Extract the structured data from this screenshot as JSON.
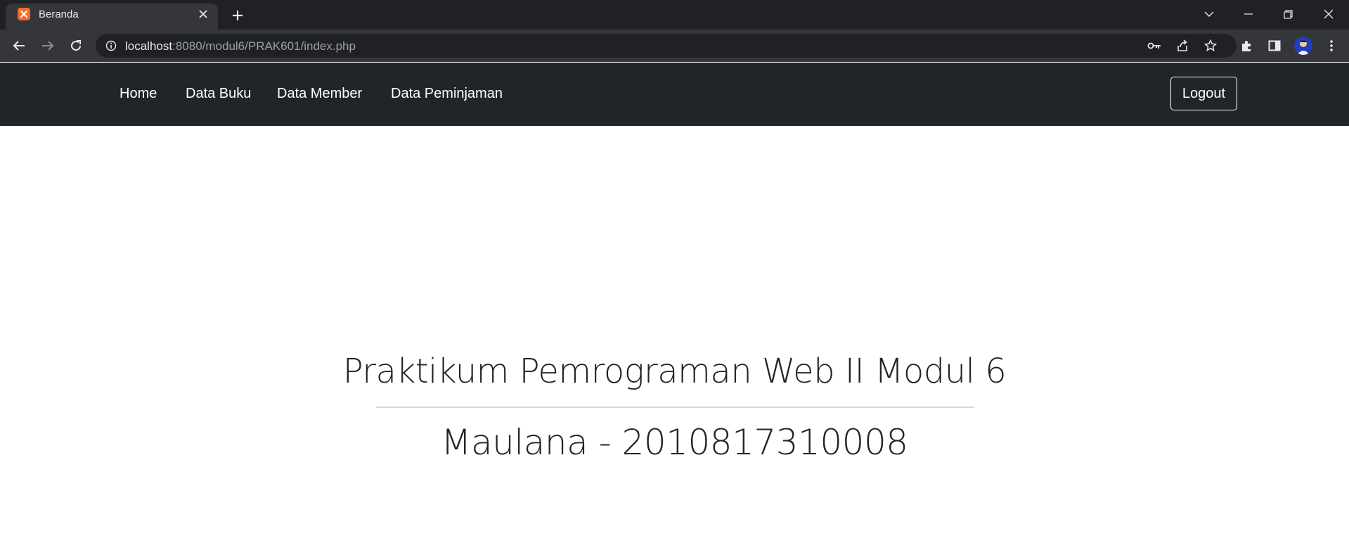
{
  "browser": {
    "tab_title": "Beranda",
    "url_host": "localhost",
    "url_rest": ":8080/modul6/PRAK601/index.php"
  },
  "icons": {
    "tab_favicon": "xampp-icon",
    "tab_close": "close-icon",
    "new_tab": "plus-icon",
    "back": "arrow-left-icon",
    "forward": "arrow-right-icon",
    "reload": "reload-icon",
    "site_info": "info-icon",
    "password": "key-icon",
    "share": "share-icon",
    "bookmark": "star-icon",
    "extensions": "puzzle-icon",
    "side_panel": "side-panel-icon",
    "profile": "avatar-icon",
    "menu": "kebab-menu-icon"
  },
  "navbar": {
    "links": [
      "Home",
      "Data Buku",
      "Data Member",
      "Data Peminjaman"
    ],
    "logout_label": "Logout"
  },
  "main": {
    "title": "Praktikum Pemrograman Web II Modul 6",
    "subtitle": "Maulana - 2010817310008"
  },
  "colors": {
    "navbar_bg": "#212529",
    "favicon": "#f56a2b",
    "text": "#212529"
  }
}
